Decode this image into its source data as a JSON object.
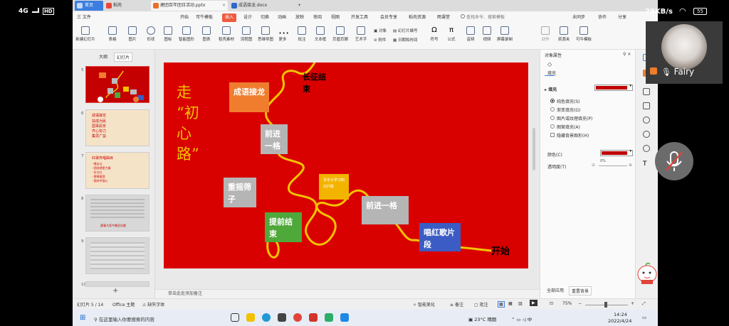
{
  "phone_status": {
    "network": "4G",
    "hd": "HD",
    "speed": "29KB/s",
    "battery": "55",
    "clock_partial": "14:24"
  },
  "tabs": {
    "home": "首页",
    "t1": "稻壳",
    "t2": "建团百年团日活动.pptx",
    "t3": "成语接龙.docx"
  },
  "menu": {
    "file": "三 文件",
    "items": [
      "开始",
      "可牛模板",
      "插入",
      "设计",
      "切换",
      "动画",
      "放映",
      "审阅",
      "视图",
      "开发工具",
      "会员专享",
      "稻壳资源",
      "雨课堂"
    ],
    "active_index": 2,
    "search": "查找命令、搜索模板",
    "sync": "未同步",
    "collab": "协作",
    "share": "分享"
  },
  "ribbon": {
    "buttons": [
      "新建幻灯片",
      "表格",
      "图片",
      "形状",
      "图标",
      "智能图形",
      "图表",
      "稻壳素材",
      "流程图",
      "思维导图",
      "更多",
      "批注",
      "文本框",
      "页眉页脚",
      "艺术字",
      "符号",
      "公式",
      "音频",
      "视频",
      "屏幕录制",
      "动作",
      "资源夹",
      "可牛模板"
    ],
    "small": {
      "object": "对象",
      "slide_no": "幻灯片编号",
      "attach": "附件",
      "datetime": "日期和时间"
    }
  },
  "left_pane": {
    "tab_outline": "大纲",
    "tab_slides": "幻灯片",
    "thumbs": [
      {
        "num": "5",
        "lines": []
      },
      {
        "num": "6",
        "lines": [
          "成语接龙",
          "扶成为民",
          "国事民安",
          "齐心协力",
          "集思广益"
        ]
      },
      {
        "num": "7",
        "lines": [
          "红歌传唱曲目",
          "· 唱支山",
          "· 团结就是力量",
          "· 东方红",
          "· 歌唱祖国",
          "· 我的中国心"
        ]
      },
      {
        "num": "8",
        "lines": [
          "赛事大家今晚回访题"
        ]
      },
      {
        "num": "9",
        "lines": []
      },
      {
        "num": "10",
        "lines": []
      }
    ]
  },
  "slide": {
    "vertical_title": [
      "走",
      "“初",
      "心",
      "路”"
    ],
    "start": "开始",
    "end_line1": "长征结",
    "end_line2": "束",
    "boxes": {
      "idiom": "成语接龙",
      "forward_top": "前进一格",
      "beat_drum": "重摇筛子",
      "early_end": "提前结束",
      "small_yellow": "青年大学习知识问答",
      "forward_mid": "前进一格",
      "sing_red": "唱红歌片段"
    }
  },
  "notes": "单击此处添加备注",
  "right_panel": {
    "title": "对象属性",
    "fill_tab": "填充",
    "fill_label": "填充",
    "options": [
      "纯色填充(S)",
      "渐变填充(G)",
      "图片或纹理填充(P)",
      "图案填充(A)"
    ],
    "hide_bg": "隐藏背景图形(H)",
    "color_label": "颜色(C)",
    "transparency_label": "透明度(T)",
    "transparency_value": "0%",
    "apply_all": "全部应用",
    "reset_bg": "重置背景",
    "fill_color": "#c00000"
  },
  "status": {
    "slide_info": "幻灯片 5 / 14",
    "theme": "Office 主题",
    "missing_font": "缺失字体",
    "beautify": "智能美化",
    "notes": "备注",
    "comments": "批注",
    "zoom": "75%"
  },
  "taskbar": {
    "search": "在这里输入你要搜索的内容",
    "weather_temp": "23°C",
    "weather_text": "晴朗",
    "time": "14:24",
    "date": "2022/4/24"
  },
  "participant": {
    "name": "Fairy"
  }
}
